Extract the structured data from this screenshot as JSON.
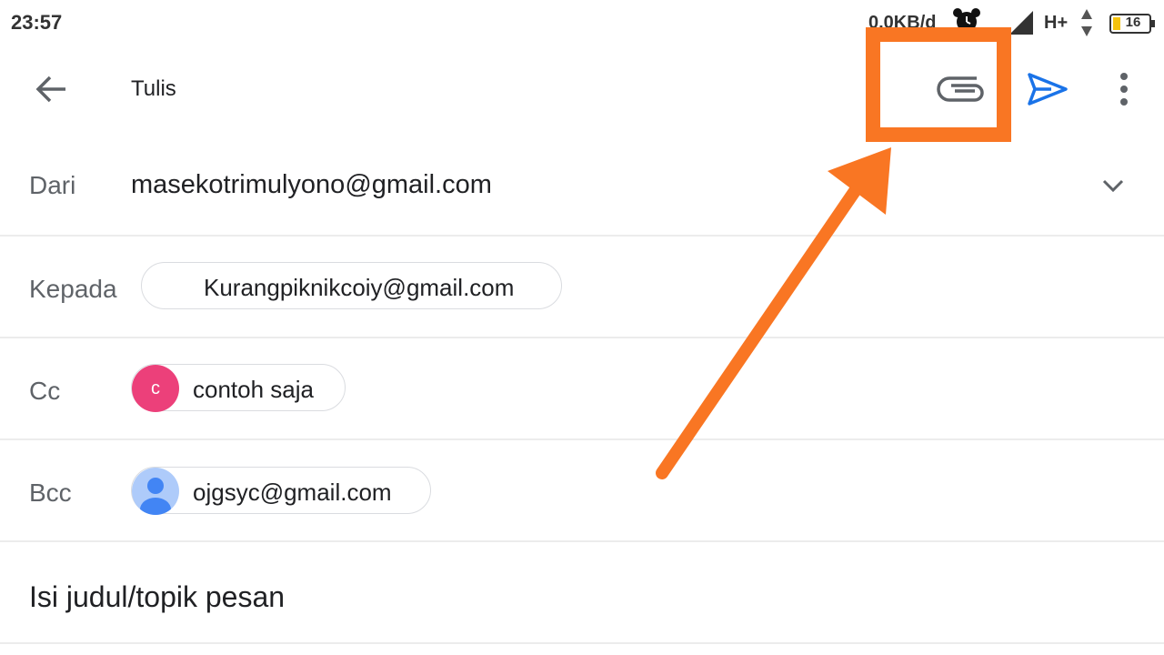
{
  "status_bar": {
    "time": "23:57",
    "net_speed": "0,0KB/d",
    "network_type": "H+",
    "battery_level": "16"
  },
  "toolbar": {
    "title": "Tulis"
  },
  "compose": {
    "from": {
      "label": "Dari",
      "value": "masekotrimulyono@gmail.com"
    },
    "to": {
      "label": "Kepada",
      "chip_text": "Kurangpiknikcoiy@gmail.com"
    },
    "cc": {
      "label": "Cc",
      "avatar_letter": "c",
      "chip_text": "contoh saja"
    },
    "bcc": {
      "label": "Bcc",
      "chip_text": "ojgsyc@gmail.com"
    },
    "subject": {
      "text": "Isi judul/topik pesan"
    }
  },
  "colors": {
    "annotation": "#f97623",
    "send_icon": "#1a73e8",
    "cc_avatar": "#ec407a",
    "bcc_avatar": "#aecbfa"
  }
}
